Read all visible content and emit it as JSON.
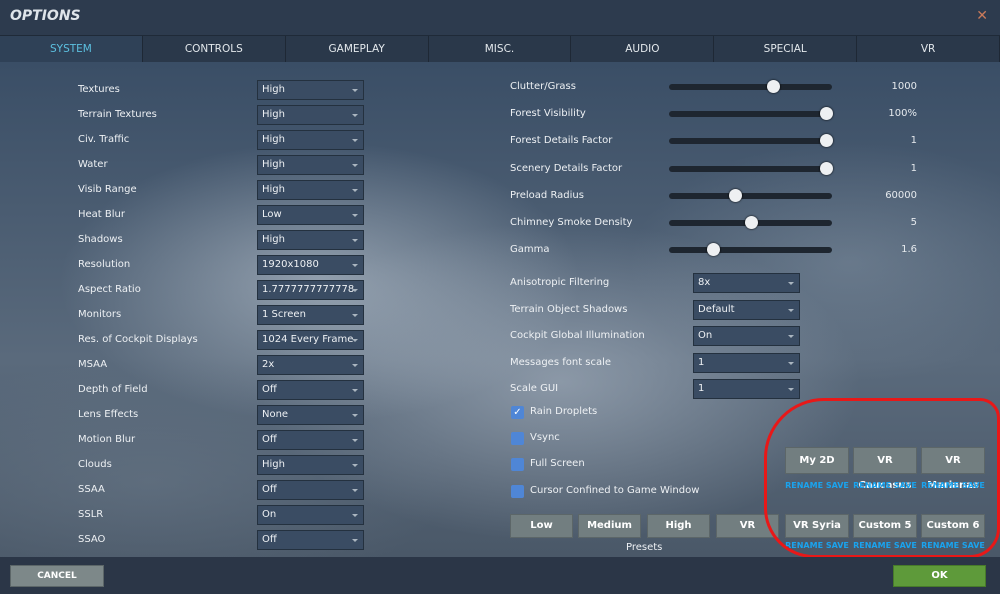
{
  "title": "OPTIONS",
  "tabs": [
    "SYSTEM",
    "CONTROLS",
    "GAMEPLAY",
    "MISC.",
    "AUDIO",
    "SPECIAL",
    "VR"
  ],
  "left_settings": [
    {
      "label": "Textures",
      "value": "High"
    },
    {
      "label": "Terrain Textures",
      "value": "High"
    },
    {
      "label": "Civ. Traffic",
      "value": "High"
    },
    {
      "label": "Water",
      "value": "High"
    },
    {
      "label": "Visib Range",
      "value": "High"
    },
    {
      "label": "Heat Blur",
      "value": "Low"
    },
    {
      "label": "Shadows",
      "value": "High"
    },
    {
      "label": "Resolution",
      "value": "1920x1080"
    },
    {
      "label": "Aspect Ratio",
      "value": "1.7777777777778"
    },
    {
      "label": "Monitors",
      "value": "1 Screen"
    },
    {
      "label": "Res. of Cockpit Displays",
      "value": "1024 Every Frame"
    },
    {
      "label": "MSAA",
      "value": "2x"
    },
    {
      "label": "Depth of Field",
      "value": "Off"
    },
    {
      "label": "Lens Effects",
      "value": "None"
    },
    {
      "label": "Motion Blur",
      "value": "Off"
    },
    {
      "label": "Clouds",
      "value": "High"
    },
    {
      "label": "SSAA",
      "value": "Off"
    },
    {
      "label": "SSLR",
      "value": "On"
    },
    {
      "label": "SSAO",
      "value": "Off"
    }
  ],
  "sliders": [
    {
      "label": "Clutter/Grass",
      "value": "1000",
      "fraction": 0.65
    },
    {
      "label": "Forest Visibility",
      "value": "100%",
      "fraction": 1.0
    },
    {
      "label": "Forest Details Factor",
      "value": "1",
      "fraction": 1.0
    },
    {
      "label": "Scenery Details Factor",
      "value": "1",
      "fraction": 1.0
    },
    {
      "label": "Preload Radius",
      "value": "60000",
      "fraction": 0.4
    },
    {
      "label": "Chimney Smoke Density",
      "value": "5",
      "fraction": 0.5
    },
    {
      "label": "Gamma",
      "value": "1.6",
      "fraction": 0.25
    }
  ],
  "right_settings": [
    {
      "label": "Anisotropic Filtering",
      "value": "8x"
    },
    {
      "label": "Terrain Object Shadows",
      "value": "Default"
    },
    {
      "label": "Cockpit Global Illumination",
      "value": "On"
    },
    {
      "label": "Messages font scale",
      "value": "1"
    },
    {
      "label": "Scale GUI",
      "value": "1"
    }
  ],
  "checkboxes": [
    {
      "label": "Rain Droplets",
      "checked": true
    },
    {
      "label": "Vsync",
      "checked": false
    },
    {
      "label": "Full Screen",
      "checked": false
    },
    {
      "label": "Cursor Confined to Game Window",
      "checked": false
    }
  ],
  "presets": {
    "label": "Presets",
    "buttons": [
      "Low",
      "Medium",
      "High",
      "VR"
    ]
  },
  "custom_presets": [
    {
      "name": "My 2D",
      "rename": "RENAME",
      "save": "SAVE"
    },
    {
      "name": "VR Caucasus",
      "rename": "RENAME",
      "save": "SAVE"
    },
    {
      "name": "VR Marianas",
      "rename": "RENAME",
      "save": "SAVE"
    },
    {
      "name": "VR Syria",
      "rename": "RENAME",
      "save": "SAVE"
    },
    {
      "name": "Custom 5",
      "rename": "RENAME",
      "save": "SAVE"
    },
    {
      "name": "Custom 6",
      "rename": "RENAME",
      "save": "SAVE"
    }
  ],
  "footer": {
    "cancel": "CANCEL",
    "ok": "OK"
  }
}
